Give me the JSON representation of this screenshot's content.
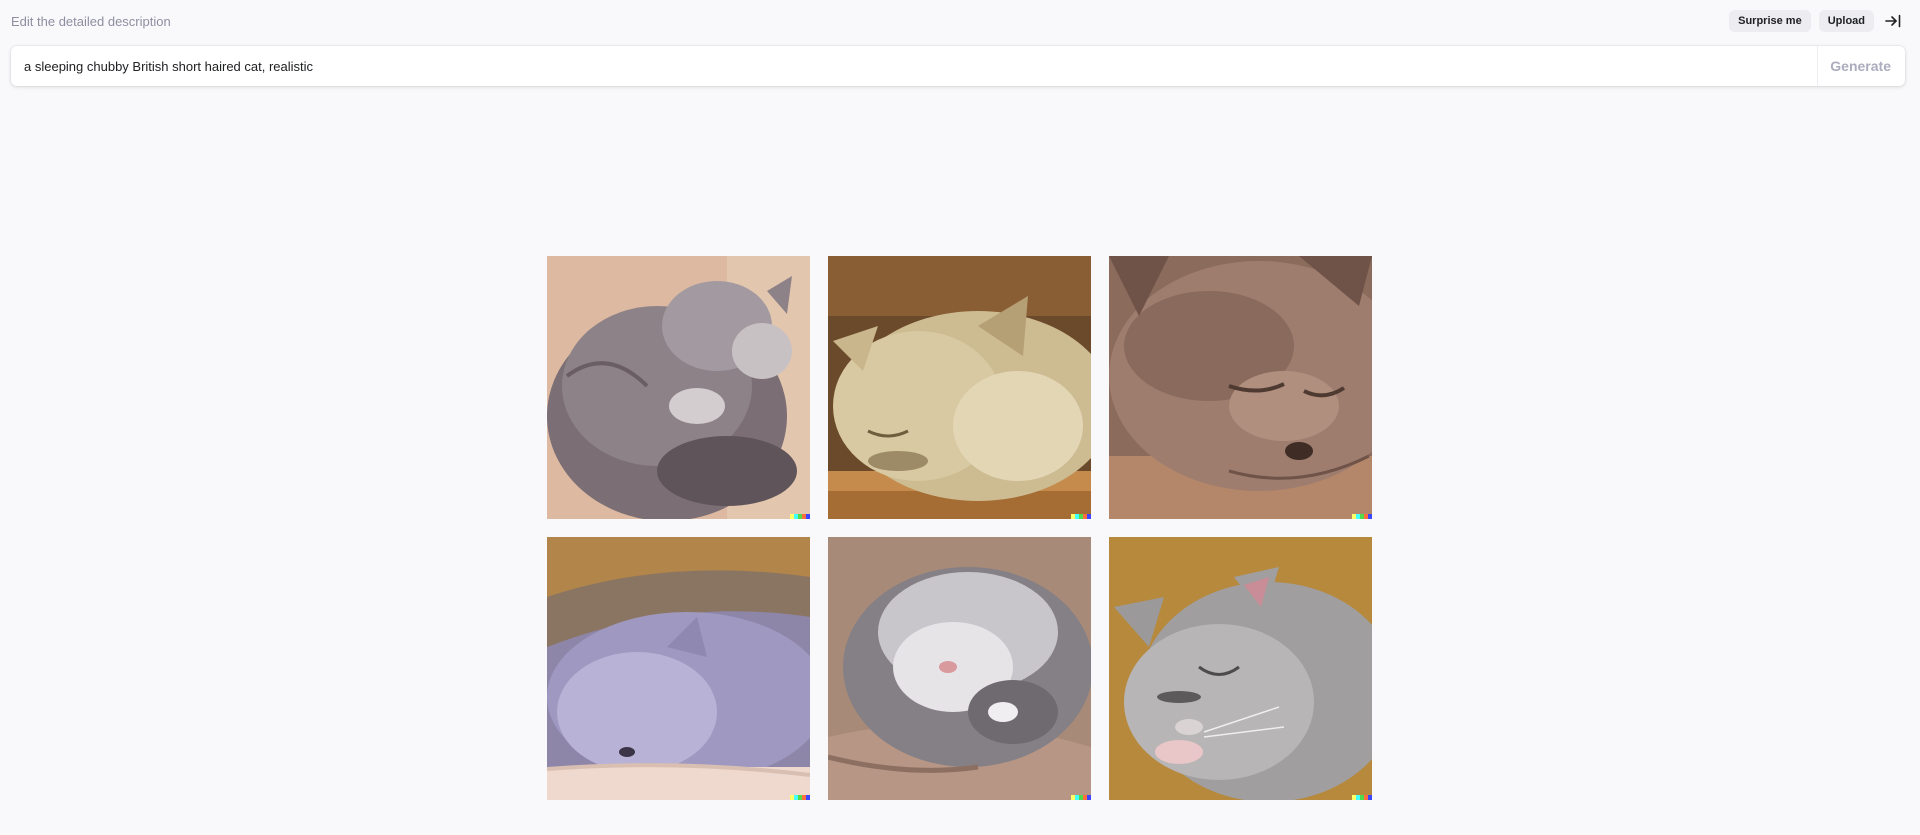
{
  "header": {
    "hint": "Edit the detailed description",
    "surprise_label": "Surprise me",
    "upload_label": "Upload",
    "exit_icon": "arrow-right-to-bar-icon"
  },
  "prompt": {
    "value": "a sleeping chubby British short haired cat, realistic",
    "generate_label": "Generate"
  },
  "results": {
    "images": [
      {
        "alt": "",
        "description_icon": "cat-image"
      },
      {
        "alt": "",
        "description_icon": "cat-image"
      },
      {
        "alt": "",
        "description_icon": "cat-image"
      },
      {
        "alt": "",
        "description_icon": "cat-image"
      },
      {
        "alt": "",
        "description_icon": "cat-image"
      },
      {
        "alt": "",
        "description_icon": "cat-image"
      }
    ],
    "signature_colors": [
      "#ffff66",
      "#42ffff",
      "#51da4c",
      "#ff6e3c",
      "#3c46ff"
    ]
  }
}
